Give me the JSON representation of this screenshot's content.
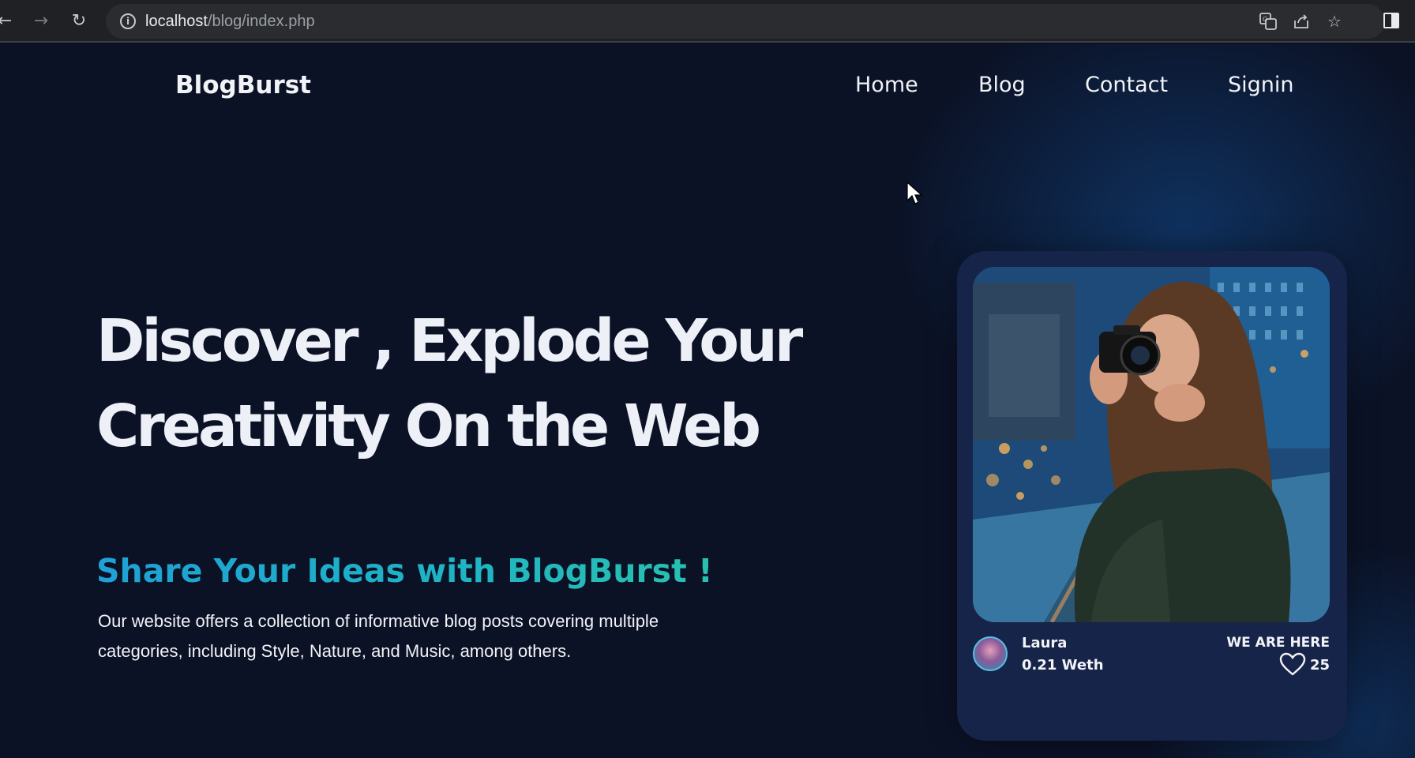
{
  "browser": {
    "url_host": "localhost",
    "url_path": "/blog/index.php"
  },
  "site": {
    "logo": "BlogBurst",
    "nav": [
      {
        "label": "Home"
      },
      {
        "label": "Blog"
      },
      {
        "label": "Contact"
      },
      {
        "label": "Signin"
      }
    ]
  },
  "hero": {
    "title_line1": "Discover , Explode Your",
    "title_line2": "Creativity On the Web",
    "subtitle": "Share Your Ideas with BlogBurst !",
    "description": "Our website offers a collection of informative blog posts covering multiple categories, including Style, Nature, and Music, among others."
  },
  "card": {
    "author_name": "Laura",
    "author_price": "0.21 Weth",
    "tag": "WE ARE HERE",
    "likes": "25"
  },
  "colors": {
    "background": "#0b1226",
    "card": "#16244a",
    "gradient_start": "#1fa0d6",
    "gradient_end": "#2cc5a8"
  }
}
